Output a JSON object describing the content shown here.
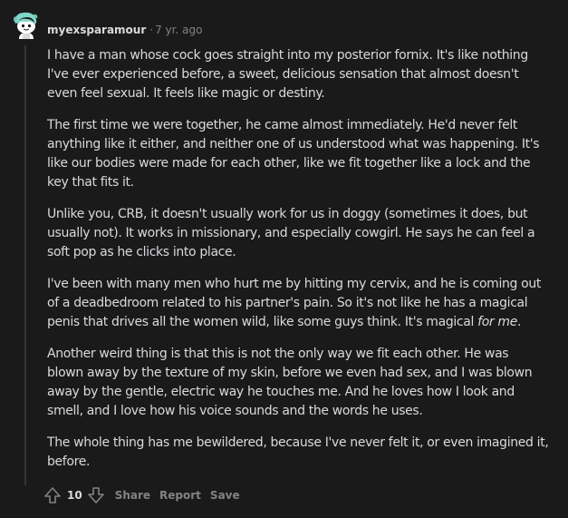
{
  "comment": {
    "author": "myexsparamour",
    "separator": "·",
    "timestamp": "7 yr. ago",
    "paragraphs": [
      [
        "I have a man whose cock goes straight into my posterior fornix. It's like nothing",
        "I've ever experienced before, a sweet, delicious sensation that almost doesn't",
        "even feel sexual. It feels like magic or destiny."
      ],
      [
        "The first time we were together, he came almost immediately. He'd never felt",
        "anything like it either, and neither one of us understood what was happening. It's",
        "like our bodies were made for each other, like we fit together like a lock and the",
        "key that fits it."
      ],
      [
        "Unlike you, CRB, it doesn't usually work for us in doggy (sometimes it does, but",
        "usually not). It works in missionary, and especially cowgirl. He says he can feel a",
        "soft pop as he clicks into place."
      ],
      [
        "I've been with many men who hurt me by hitting my cervix, and he is coming out",
        "of a deadbedroom related to his partner's pain. So it's not like he has a magical",
        "penis that drives all the women wild, like some guys think. It's magical "
      ],
      [
        "Another weird thing is that this is not the only way we fit each other. He was",
        "blown away by the texture of my skin, before we even had sex, and I was blown",
        "away by the gentle, electric way he touches me. And he loves how I look and",
        "smell, and I love how his voice sounds and the words he uses."
      ],
      [
        "The whole thing has me bewildered, because I've never felt it, or even imagined it,",
        "before."
      ]
    ],
    "emphasis": "for me",
    "emphasis_tail": ".",
    "score": "10",
    "actions": {
      "share": "Share",
      "report": "Report",
      "save": "Save"
    },
    "icons": {
      "upvote": "upvote-arrow-icon",
      "downvote": "downvote-arrow-icon",
      "avatar": "snoo-avatar-icon"
    },
    "colors": {
      "background": "#1a1a1b",
      "text": "#d7dadc",
      "muted": "#818384",
      "avatar_hair": "#7fd6c9"
    }
  }
}
